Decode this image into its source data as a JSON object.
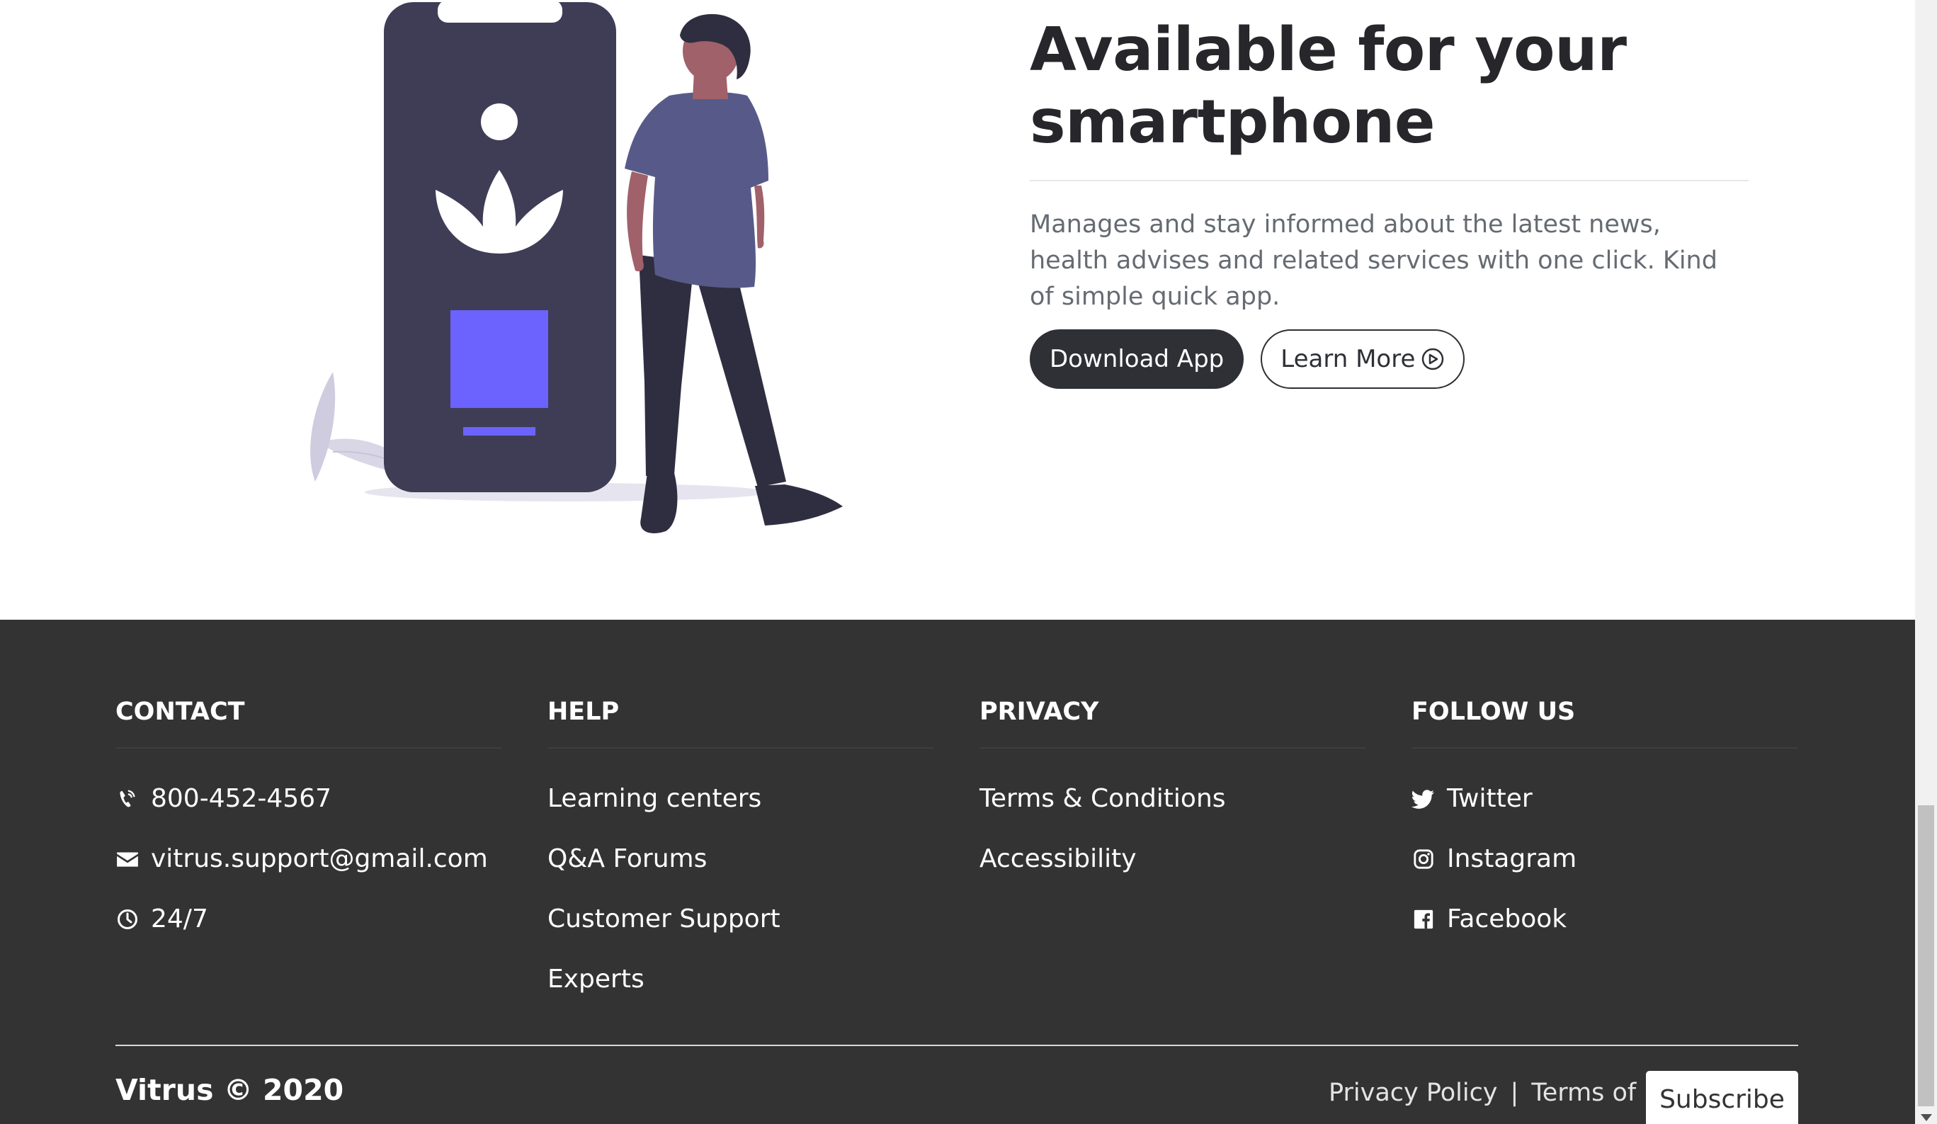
{
  "hero": {
    "title_line1": "Available for your",
    "title_line2": "smartphone",
    "description": "Manages and stay informed about the latest news, health advises and related services with one click. Kind of simple quick app.",
    "download_label": "Download App",
    "learn_more_label": "Learn More"
  },
  "footer": {
    "contact": {
      "heading": "CONTACT",
      "items": [
        {
          "icon": "phone-icon",
          "text": "800-452-4567"
        },
        {
          "icon": "envelope-icon",
          "text": "vitrus.support@gmail.com"
        },
        {
          "icon": "clock-icon",
          "text": "24/7"
        }
      ]
    },
    "help": {
      "heading": "HELP",
      "items": [
        "Learning centers",
        "Q&A Forums",
        "Customer Support",
        "Experts"
      ]
    },
    "privacy": {
      "heading": "PRIVACY",
      "items": [
        "Terms & Conditions",
        "Accessibility"
      ]
    },
    "follow": {
      "heading": "FOLLOW US",
      "items": [
        {
          "icon": "twitter-icon",
          "text": "Twitter"
        },
        {
          "icon": "instagram-icon",
          "text": "Instagram"
        },
        {
          "icon": "facebook-icon",
          "text": "Facebook"
        }
      ]
    },
    "brand": "Vitrus © 2020",
    "privacy_policy": "Privacy Policy",
    "separator": "|",
    "terms_of_use": "Terms of use",
    "subscribe_label": "Subscribe"
  },
  "colors": {
    "footer_bg": "#333333",
    "button_dark": "#2e3035",
    "illustration_phone": "#3f3d56",
    "illustration_accent": "#6c63ff",
    "illustration_shirt": "#575a89"
  }
}
